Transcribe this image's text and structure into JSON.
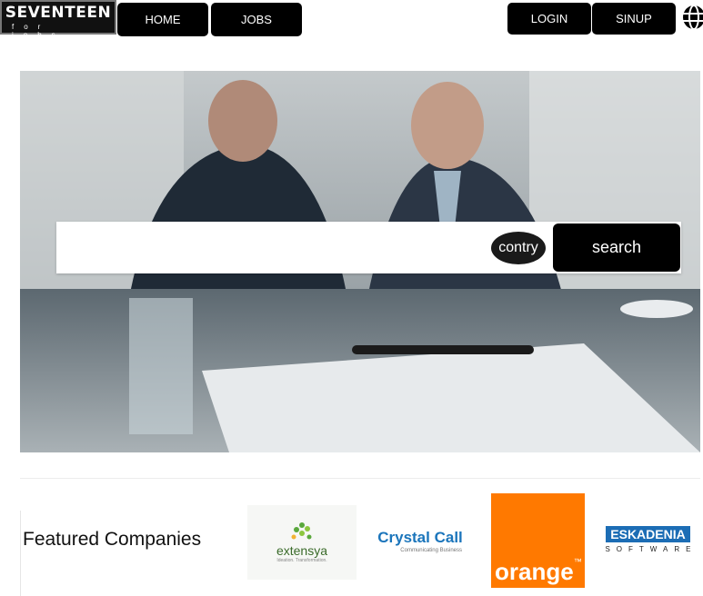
{
  "header": {
    "logo": {
      "main": "SEVENTEEN",
      "sub": "for jobs"
    },
    "nav": {
      "home": "HOME",
      "jobs": "JOBS",
      "login": "LOGIN",
      "signup": "SINUP"
    },
    "language_icon": "globe-icon"
  },
  "hero": {
    "search": {
      "input_value": "",
      "input_placeholder": "",
      "country_label": "contry",
      "search_label": "search"
    }
  },
  "featured": {
    "title": "Featured Companies",
    "companies": [
      {
        "name": "extensya",
        "tagline": "Ideation. Transformation."
      },
      {
        "name": "Crystal Call",
        "tagline": "Communicating Business"
      },
      {
        "name": "orange",
        "mark": "™"
      },
      {
        "name": "ESKADENIA",
        "tagline": "SOFTWARE"
      }
    ]
  },
  "colors": {
    "dark": "#000000",
    "orange": "#ff7900",
    "crystal_blue": "#1b75bb",
    "eskadenia_blue": "#1c6db5",
    "extensya_green": "#5aa83c"
  }
}
